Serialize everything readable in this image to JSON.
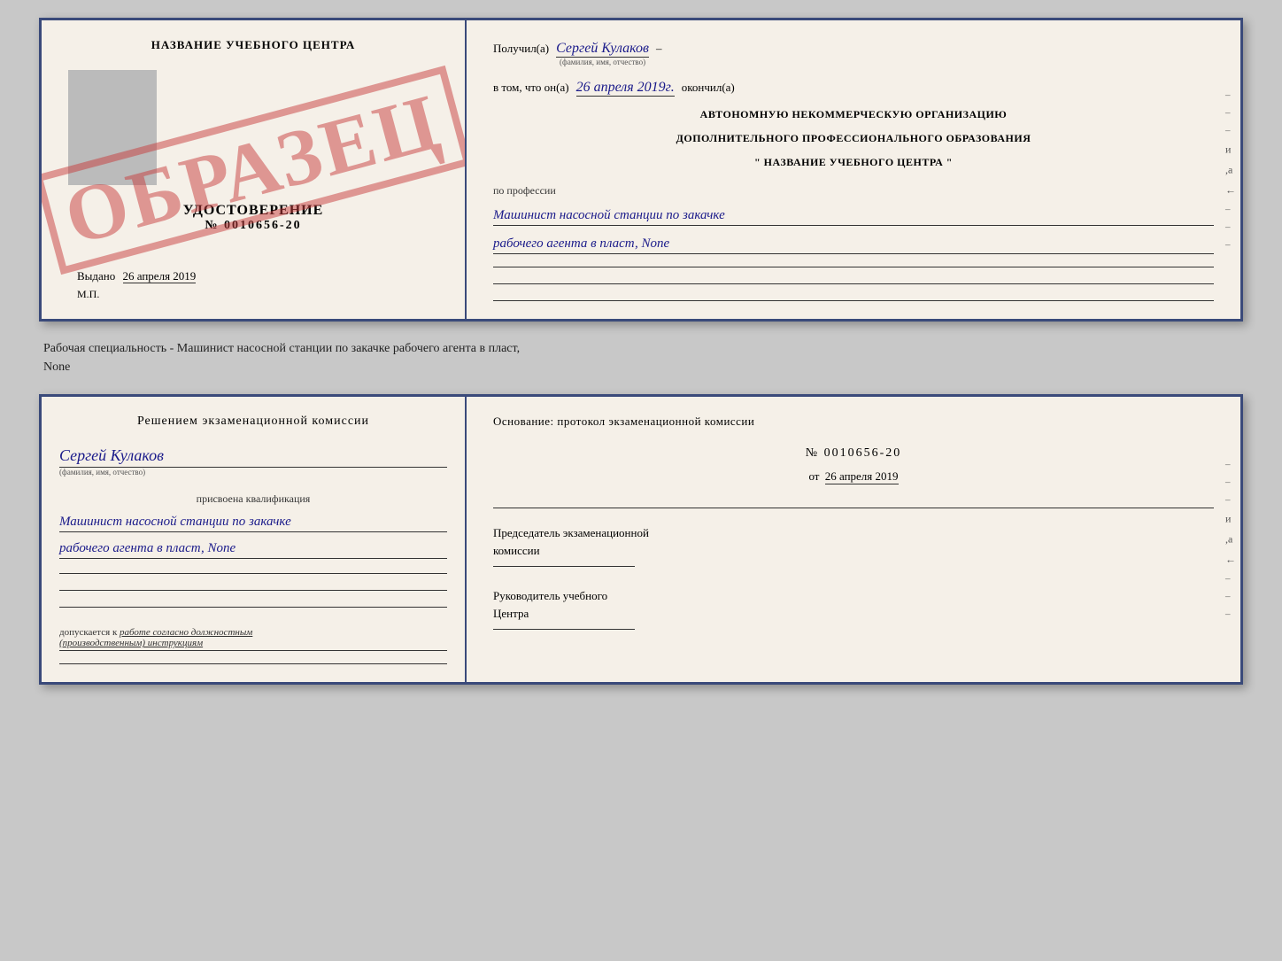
{
  "top_doc": {
    "left": {
      "center_title": "НАЗВАНИЕ УЧЕБНОГО ЦЕНТРА",
      "stamp_text": "ОБРАЗЕЦ",
      "cert_label": "УДОСТОВЕРЕНИЕ",
      "cert_number": "№ 0010656-20",
      "issued_label": "Выдано",
      "issued_date": "26 апреля 2019",
      "mp_label": "М.П."
    },
    "right": {
      "received_prefix": "Получил(а)",
      "received_name": "Сергей Кулаков",
      "name_sublabel": "(фамилия, имя, отчество)",
      "date_prefix": "в том, что он(а)",
      "date_value": "26 апреля 2019г.",
      "finished_suffix": "окончил(а)",
      "org_line1": "АВТОНОМНУЮ НЕКОММЕРЧЕСКУЮ ОРГАНИЗАЦИЮ",
      "org_line2": "ДОПОЛНИТЕЛЬНОГО ПРОФЕССИОНАЛЬНОГО ОБРАЗОВАНИЯ",
      "org_line3": "\"  НАЗВАНИЕ УЧЕБНОГО ЦЕНТРА  \"",
      "profession_prefix": "по профессии",
      "profession_line1": "Машинист насосной станции по закачке",
      "profession_line2": "рабочего агента в пласт, None",
      "side_marks": [
        "-",
        "-",
        "-",
        "и",
        ",а",
        "←",
        "-",
        "-",
        "-"
      ]
    }
  },
  "specialty_text": "Рабочая специальность - Машинист насосной станции по закачке рабочего агента в пласт,\nNone",
  "bottom_doc": {
    "left": {
      "commission_text": "Решением экзаменационной комиссии",
      "name": "Сергей Кулаков",
      "name_sublabel": "(фамилия, имя, отчество)",
      "assigned_label": "присвоена квалификация",
      "qualification_line1": "Машинист насосной станции по закачке",
      "qualification_line2": "рабочего агента в пласт, None",
      "allow_text_prefix": "допускается к",
      "allow_text_em": "работе согласно должностным\n(производственным) инструкциям"
    },
    "right": {
      "basis_text": "Основание: протокол экзаменационной комиссии",
      "protocol_number": "№ 0010656-20",
      "date_prefix": "от",
      "date_value": "26 апреля 2019",
      "chairman_label1": "Председатель экзаменационной",
      "chairman_label2": "комиссии",
      "director_label1": "Руководитель учебного",
      "director_label2": "Центра",
      "side_marks": [
        "-",
        "-",
        "-",
        "и",
        ",а",
        "←",
        "-",
        "-",
        "-"
      ]
    }
  }
}
